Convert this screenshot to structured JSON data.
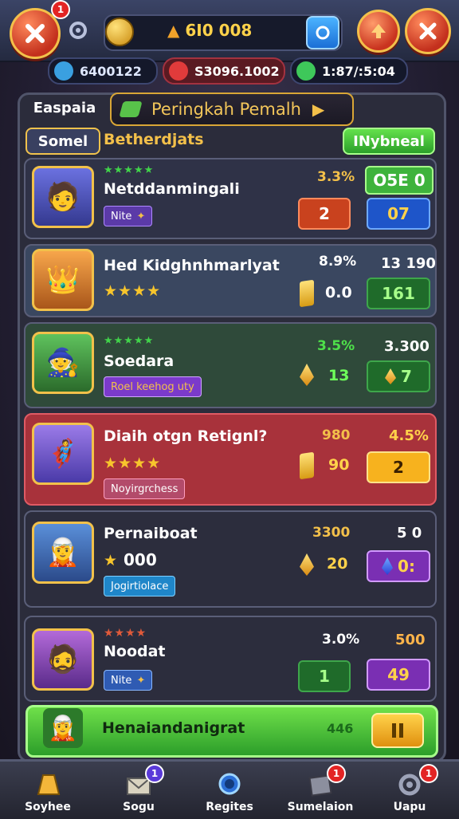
{
  "header": {
    "currency_value": "6I0 008",
    "resources": [
      "6400122",
      "S3096.1002",
      "1:87/:5:04"
    ],
    "close_badge": "1"
  },
  "panel": {
    "small_tab": "Easpaia",
    "banner_title": "Peringkah Pemalh",
    "filter_tab": "Somel",
    "filter_label": "Betherdjats",
    "right_button": "INybneal"
  },
  "rows": [
    {
      "name": "Netddanmingali",
      "stars": "★★★★★",
      "tag": "Nite",
      "pct": "3.3%",
      "left_box": "2",
      "right_top": "O5E 0",
      "right_box": "07",
      "colors": {
        "bg": "#2f3247"
      }
    },
    {
      "name": "Hed Kidghnhmarlyat",
      "stars": "★★★★",
      "pct": "8.9%",
      "mid_val": "0.0",
      "right_top": "13 190",
      "right_box": "161",
      "colors": {
        "bg": "#3a4760"
      }
    },
    {
      "name": "Soedara",
      "stars": "★★★★★",
      "tag": "Roel keehog uty",
      "pct": "3.5%",
      "mid_val": "13",
      "right_top": "3.300",
      "right_box": "7",
      "colors": {
        "bg": "#2f4a3a"
      }
    },
    {
      "name": "Diaih otgn Retignl?",
      "stars": "★★★★",
      "tag": "Noyirgrchess",
      "pct": "980",
      "mid_val": "90",
      "right_top": "4.5%",
      "right_box": "2",
      "colors": {
        "bg": "#a8323b"
      }
    },
    {
      "name": "Pernaiboat",
      "stars": "★",
      "stars_val": "000",
      "tag": "Jogirtiolace",
      "pct": "3300",
      "mid_val": "20",
      "right_top": "5 0",
      "right_box": "0:",
      "colors": {
        "bg": "#2c2d3d"
      }
    },
    {
      "name": "Noodat",
      "stars": "★★★★",
      "tag": "Nite",
      "pct": "3.0%",
      "left_box": "1",
      "right_top": "500",
      "right_box": "49",
      "colors": {
        "bg": "#2c2d3d"
      }
    }
  ],
  "footer_row": {
    "name": "Henaiandanigrat",
    "val": "446"
  },
  "nav": [
    {
      "label": "Soyhee",
      "badge": ""
    },
    {
      "label": "Sogu",
      "badge": "1"
    },
    {
      "label": "Regites",
      "badge": ""
    },
    {
      "label": "Sumelaion",
      "badge": "1"
    },
    {
      "label": "Uapu",
      "badge": "1"
    }
  ]
}
